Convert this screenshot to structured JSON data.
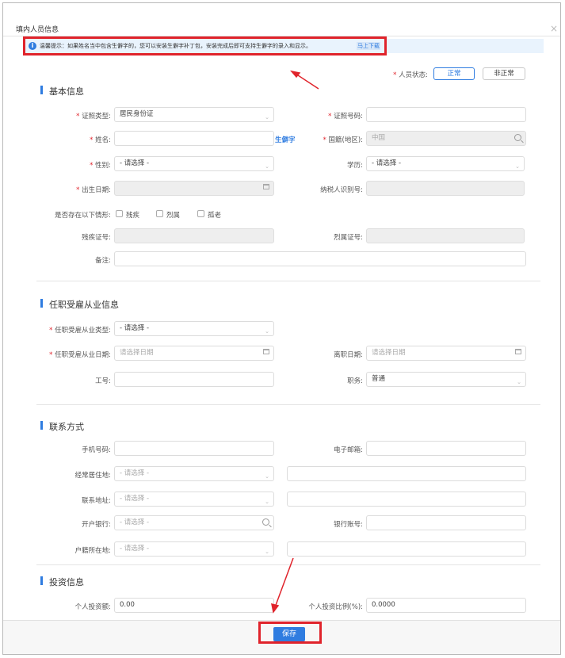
{
  "dialog": {
    "title": "填内人员信息",
    "close_icon": "×"
  },
  "notice": {
    "text": "温馨提示：如果姓名当中包含生僻字的，您可以安装生僻字补丁包，安装完成后即可支持生僻字的录入和显示。",
    "link": "马上下载"
  },
  "status": {
    "label": "人员状态:",
    "options": [
      "正常",
      "非正常"
    ],
    "selected": "正常"
  },
  "basic": {
    "title": "基本信息",
    "id_type": {
      "label": "证照类型:",
      "value": "居民身份证"
    },
    "id_no": {
      "label": "证照号码:",
      "value": ""
    },
    "name": {
      "label": "姓名:",
      "value": ""
    },
    "rare_char_link": "生僻字",
    "nation": {
      "label": "国籍(地区):",
      "placeholder": "中国"
    },
    "gender": {
      "label": "性别:",
      "value": "- 请选择 -"
    },
    "education": {
      "label": "学历:",
      "value": "- 请选择 -"
    },
    "birth": {
      "label": "出生日期:"
    },
    "taxpayer_id": {
      "label": "纳税人识别号:"
    },
    "situations": {
      "label": "是否存在以下情形:",
      "options": [
        "残疾",
        "烈属",
        "孤老"
      ]
    },
    "disability_no": {
      "label": "残疾证号:"
    },
    "martyr_no": {
      "label": "烈属证号:"
    },
    "remark": {
      "label": "备注:"
    }
  },
  "employment": {
    "title": "任职受雇从业信息",
    "type": {
      "label": "任职受雇从业类型:",
      "value": "- 请选择 -"
    },
    "date": {
      "label": "任职受雇从业日期:",
      "placeholder": "请选择日期"
    },
    "leave_date": {
      "label": "离职日期:",
      "placeholder": "请选择日期"
    },
    "job_no": {
      "label": "工号:"
    },
    "position": {
      "label": "职务:",
      "value": "普通"
    }
  },
  "contact": {
    "title": "联系方式",
    "phone": {
      "label": "手机号码:"
    },
    "email": {
      "label": "电子邮箱:"
    },
    "residence": {
      "label": "经常居住地:",
      "placeholder": "- 请选择 -"
    },
    "address": {
      "label": "联系地址:",
      "placeholder": "- 请选择 -"
    },
    "bank": {
      "label": "开户银行:",
      "placeholder": "- 请选择 -"
    },
    "account": {
      "label": "银行账号:"
    },
    "hukou": {
      "label": "户籍所在地:",
      "placeholder": "- 请选择 -"
    }
  },
  "investment": {
    "title": "投资信息",
    "amount": {
      "label": "个人投资额:",
      "value": "0.00"
    },
    "ratio": {
      "label": "个人投资比例(%):",
      "value": "0.0000"
    }
  },
  "footer": {
    "save_label": "保存"
  },
  "colors": {
    "accent": "#2f7ce0",
    "highlight": "#e0232b"
  }
}
